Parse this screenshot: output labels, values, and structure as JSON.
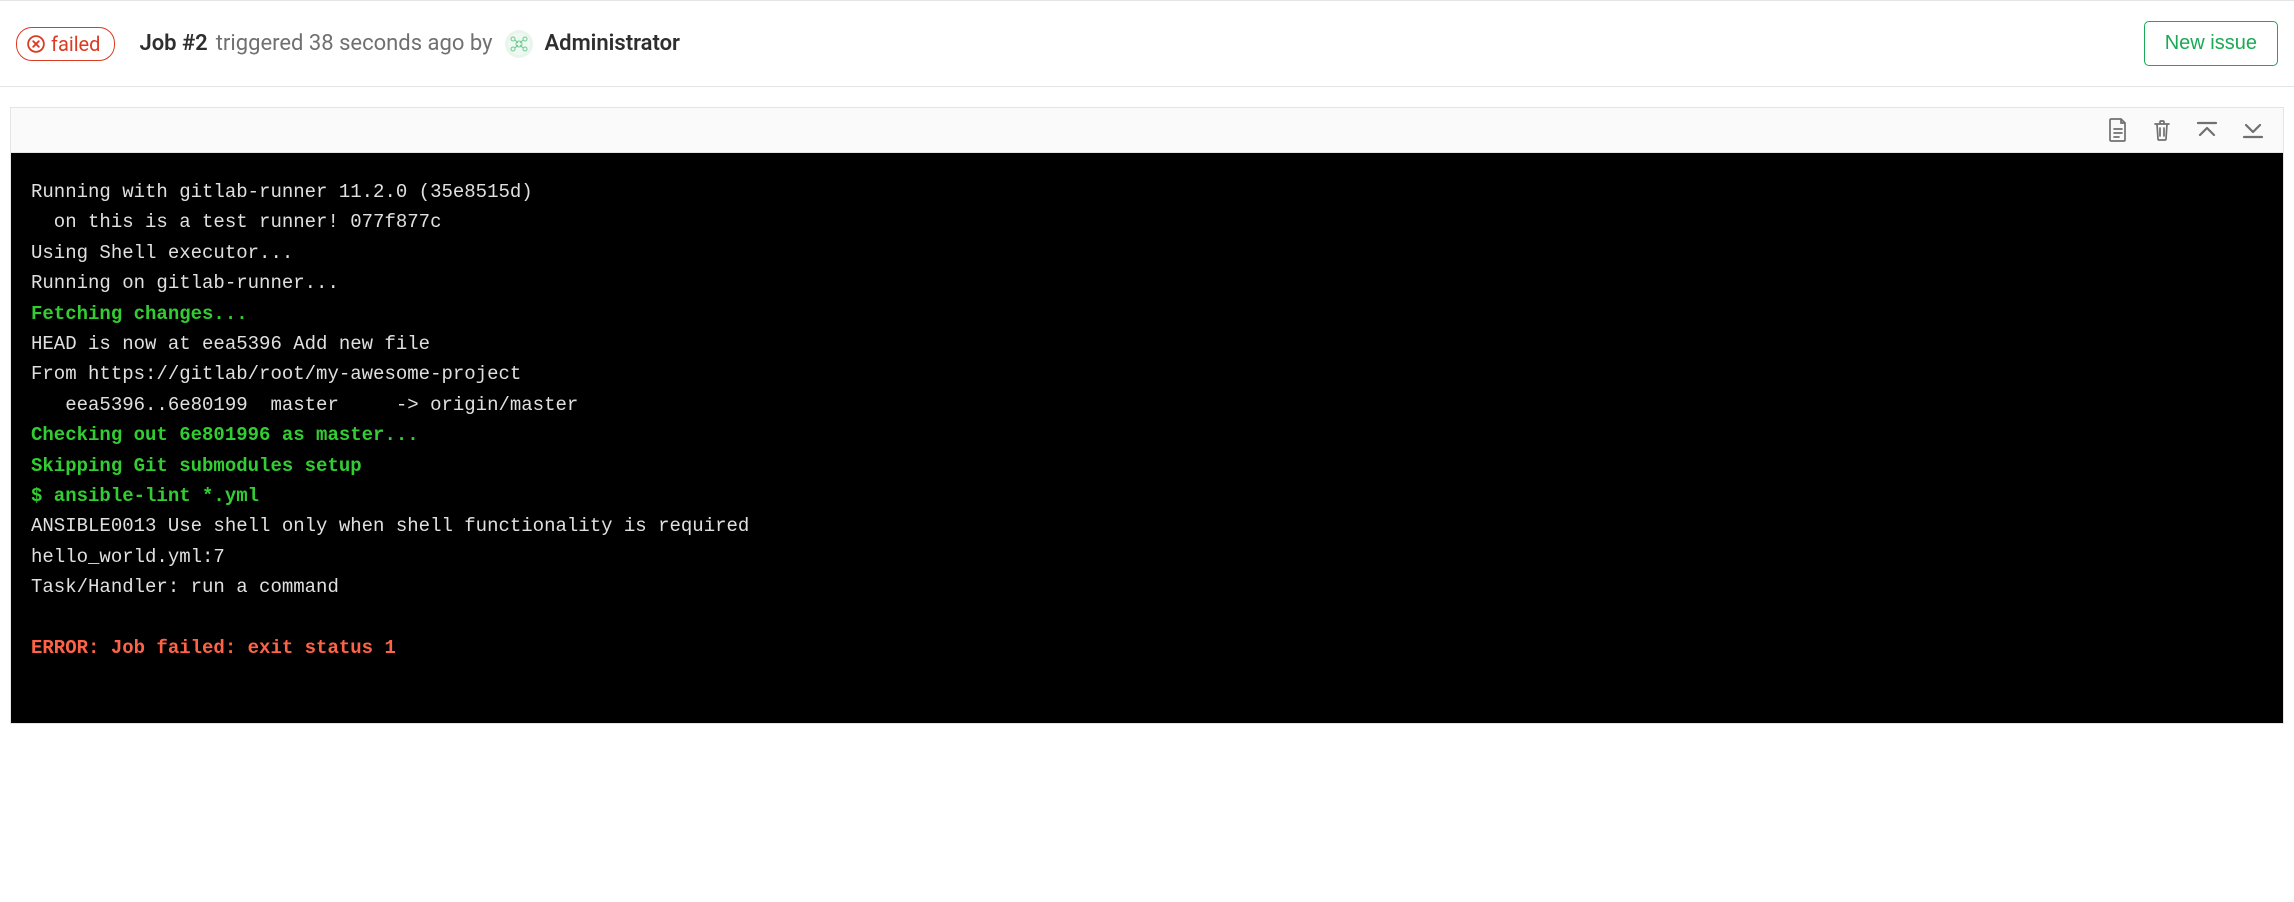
{
  "header": {
    "status": "failed",
    "job_prefix": "Job #2",
    "triggered_text": "triggered 38 seconds ago by",
    "user": "Administrator",
    "new_issue_label": "New issue"
  },
  "log": {
    "lines": [
      {
        "text": "Running with gitlab-runner 11.2.0 (35e8515d)",
        "cls": ""
      },
      {
        "text": "  on this is a test runner! 077f877c",
        "cls": ""
      },
      {
        "text": "Using Shell executor...",
        "cls": ""
      },
      {
        "text": "Running on gitlab-runner...",
        "cls": ""
      },
      {
        "text": "Fetching changes...",
        "cls": "green"
      },
      {
        "text": "HEAD is now at eea5396 Add new file",
        "cls": ""
      },
      {
        "text": "From https://gitlab/root/my-awesome-project",
        "cls": ""
      },
      {
        "text": "   eea5396..6e80199  master     -> origin/master",
        "cls": ""
      },
      {
        "text": "Checking out 6e801996 as master...",
        "cls": "green"
      },
      {
        "text": "Skipping Git submodules setup",
        "cls": "green"
      },
      {
        "text": "$ ansible-lint *.yml",
        "cls": "green"
      },
      {
        "text": "ANSIBLE0013 Use shell only when shell functionality is required",
        "cls": ""
      },
      {
        "text": "hello_world.yml:7",
        "cls": ""
      },
      {
        "text": "Task/Handler: run a command",
        "cls": ""
      },
      {
        "text": "",
        "cls": ""
      },
      {
        "text": "ERROR: Job failed: exit status 1",
        "cls": "red"
      }
    ]
  },
  "toolbar": {
    "raw_label": "Show complete raw",
    "erase_label": "Erase job log",
    "top_label": "Scroll to top",
    "bottom_label": "Scroll to bottom"
  }
}
